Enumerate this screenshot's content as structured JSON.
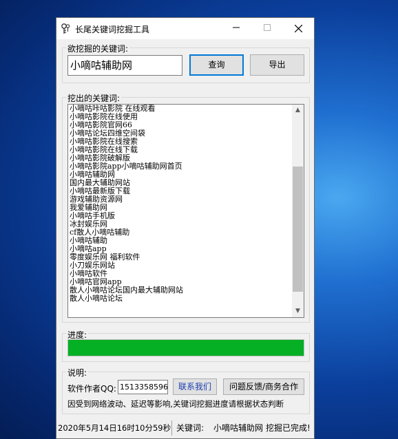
{
  "window": {
    "title": "长尾关键词挖掘工具"
  },
  "search": {
    "group_label": "欲挖掘的关键词:",
    "keyword_value": "小嘀咕辅助网",
    "query_button": "查询",
    "export_button": "导出"
  },
  "results": {
    "group_label": "挖出的关键词:",
    "items": [
      "小嘀咕咔咕影院 在线观看",
      "小嘀咕影院在线使用",
      "小嘀咕影院官网66",
      "小嘀咕论坛四维空间袋",
      "小嘀咕影院在线搜索",
      "小嘀咕影院在线下载",
      "小嘀咕影院破解版",
      "小嘀咕影院app小嘀咕辅助网首页",
      "小嘀咕辅助网",
      "国内最大辅助网站",
      "小嘀咕最新版下载",
      "游戏辅助资源网",
      "我爱辅助网",
      "小嘀咕手机版",
      "冰封娱乐网",
      "cf散人小嘀咕辅助",
      "小嘀咕辅助",
      "小嘀咕app",
      "零度娱乐网 福利软件",
      "小刀娱乐网站",
      "小嘀咕软件",
      "小嘀咕官网app",
      "散人小嘀咕论坛国内最大辅助网站",
      "散人小嘀咕论坛"
    ],
    "scroll_position": 0.78
  },
  "progress": {
    "group_label": "进度:",
    "value": 1.0,
    "color": "#06b025"
  },
  "info": {
    "group_label": "说明:",
    "author_label": "软件作者QQ:",
    "qq_value": "1513358596",
    "contact_button": "联系我们",
    "feedback_button": "问题反馈/商务合作",
    "notice": "因受到网络波动、延迟等影响,关键词挖掘进度请根据状态判断"
  },
  "status": {
    "datetime": "2020年5月14日16时10分59秒",
    "keyword_label": "关键词:",
    "keyword_value": "小嘀咕辅助网",
    "state": "挖掘已完成!"
  }
}
